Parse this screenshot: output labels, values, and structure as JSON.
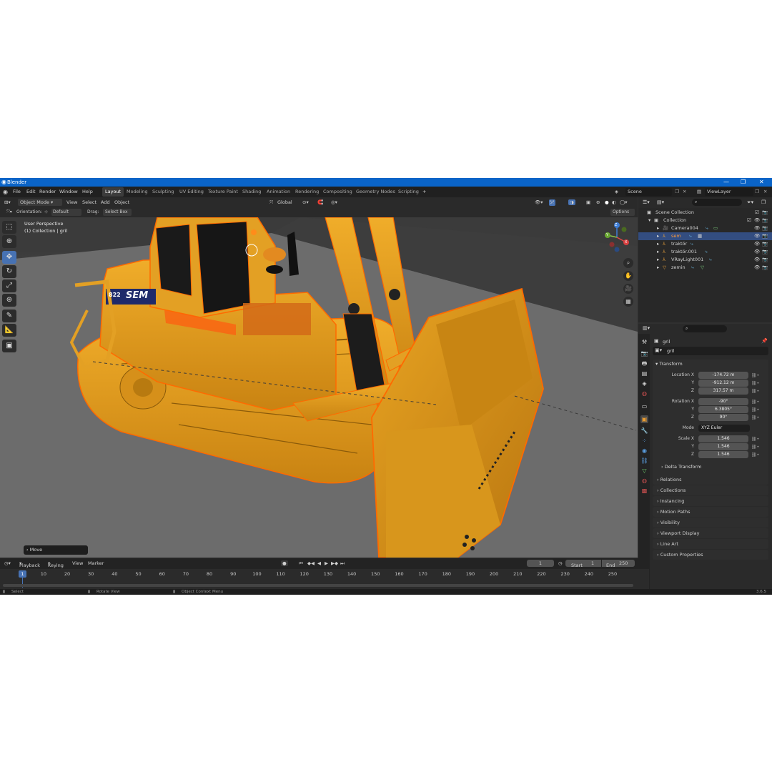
{
  "window": {
    "title": "Blender",
    "controls": [
      "—",
      "❐",
      "✕"
    ]
  },
  "menubar": {
    "menus": [
      "File",
      "Edit",
      "Render",
      "Window",
      "Help"
    ],
    "workspaces": [
      "Layout",
      "Modeling",
      "Sculpting",
      "UV Editing",
      "Texture Paint",
      "Shading",
      "Animation",
      "Rendering",
      "Compositing",
      "Geometry Nodes",
      "Scripting"
    ],
    "active_workspace": "Layout",
    "add_tab": "+",
    "scene": "Scene",
    "view_layer": "ViewLayer"
  },
  "viewport_header": {
    "mode": "Object Mode",
    "menus": [
      "View",
      "Select",
      "Add",
      "Object"
    ],
    "transform_orientation": "Global"
  },
  "tool_header": {
    "orientation_label": "Orientation:",
    "orientation_value": "Default",
    "drag_label": "Drag:",
    "drag_value": "Select Box",
    "options": "Options"
  },
  "viewport": {
    "view_name": "User Perspective",
    "collection_info": "(1) Collection | gril",
    "last_operator": "Move",
    "decal_number": "822",
    "decal_brand": "SEM",
    "gizmo_axes": {
      "x": "X",
      "y": "Y",
      "z": "Z"
    }
  },
  "outliner": {
    "search_placeholder": "",
    "root": "Scene Collection",
    "collection": "Collection",
    "items": [
      {
        "name": "Camera004",
        "icon": "camera-icon",
        "selected": false
      },
      {
        "name": "sem",
        "icon": "armature-icon",
        "selected": true
      },
      {
        "name": "traktör",
        "icon": "armature-icon",
        "selected": false
      },
      {
        "name": "traktör.001",
        "icon": "armature-icon",
        "selected": false
      },
      {
        "name": "VRayLight001",
        "icon": "armature-icon",
        "selected": false
      },
      {
        "name": "zemin",
        "icon": "mesh-icon",
        "selected": false
      }
    ]
  },
  "properties": {
    "object_name": "gril",
    "datablock_name": "gril",
    "transform_title": "Transform",
    "location": {
      "label": "Location X",
      "x": "-174.72 m",
      "y": "-912.12 m",
      "z": "317.57 m"
    },
    "rotation": {
      "label": "Rotation X",
      "x": "-90°",
      "y": "6.3805°",
      "z": "90°"
    },
    "mode_label": "Mode",
    "mode_value": "XYZ Euler",
    "scale": {
      "label": "Scale X",
      "x": "1.546",
      "y": "1.546",
      "z": "1.546"
    },
    "axis_y": "Y",
    "axis_z": "Z",
    "delta": "Delta Transform",
    "panels": [
      "Relations",
      "Collections",
      "Instancing",
      "Motion Paths",
      "Visibility",
      "Viewport Display",
      "Line Art",
      "Custom Properties"
    ]
  },
  "timeline": {
    "menus": [
      "Playback",
      "Keying",
      "View",
      "Marker"
    ],
    "current_frame": "1",
    "start_label": "Start",
    "start": "1",
    "end_label": "End",
    "end": "250",
    "ruler": [
      "1",
      "10",
      "20",
      "30",
      "40",
      "50",
      "60",
      "70",
      "80",
      "90",
      "100",
      "110",
      "120",
      "130",
      "140",
      "150",
      "160",
      "170",
      "180",
      "190",
      "200",
      "210",
      "220",
      "230",
      "240",
      "250"
    ]
  },
  "statusbar": {
    "select": "Select",
    "rotate_view": "Rotate View",
    "context_menu": "Object Context Menu",
    "version": "3.6.5"
  },
  "colors": {
    "accent": "#4772b3",
    "selection_outline": "#ff6a00",
    "model": "#e59a1c",
    "titlebar": "#0a64c8"
  }
}
